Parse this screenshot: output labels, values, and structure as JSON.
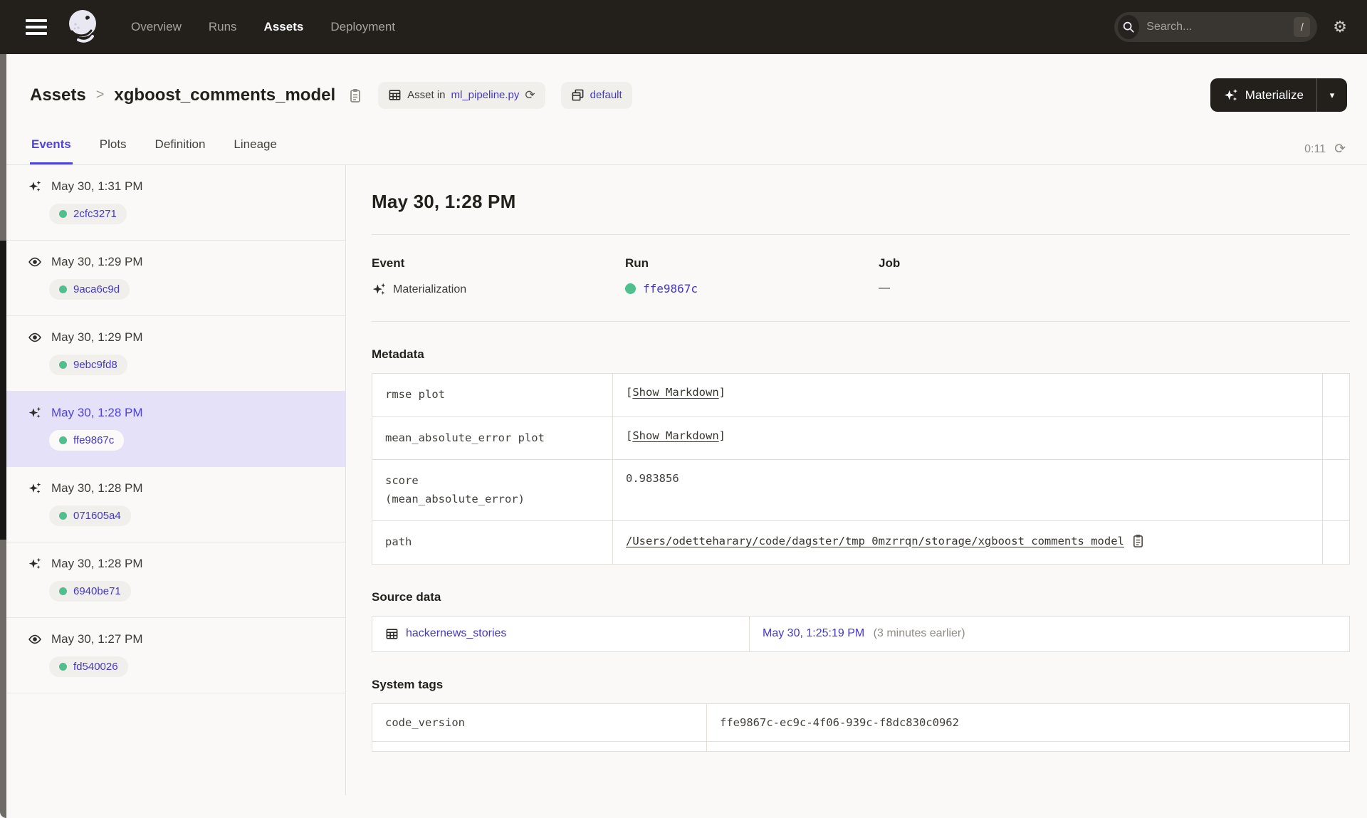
{
  "header": {
    "nav": [
      {
        "label": "Overview"
      },
      {
        "label": "Runs"
      },
      {
        "label": "Assets"
      },
      {
        "label": "Deployment"
      }
    ],
    "search": {
      "placeholder": "Search...",
      "shortcut": "/"
    }
  },
  "breadcrumb": {
    "root": "Assets",
    "separator": ">",
    "current": "xgboost_comments_model"
  },
  "asset_pill": {
    "prefix": "Asset in",
    "link": "ml_pipeline.py"
  },
  "repo_pill": {
    "label": "default"
  },
  "materialize": {
    "label": "Materialize"
  },
  "tabs": {
    "items": [
      {
        "label": "Events"
      },
      {
        "label": "Plots"
      },
      {
        "label": "Definition"
      },
      {
        "label": "Lineage"
      }
    ],
    "timer": "0:11"
  },
  "sidebar": {
    "events": [
      {
        "time": "May 30, 1:31 PM",
        "run_id": "2cfc3271",
        "type": "materialization"
      },
      {
        "time": "May 30, 1:29 PM",
        "run_id": "9aca6c9d",
        "type": "observation"
      },
      {
        "time": "May 30, 1:29 PM",
        "run_id": "9ebc9fd8",
        "type": "observation"
      },
      {
        "time": "May 30, 1:28 PM",
        "run_id": "ffe9867c",
        "type": "materialization",
        "selected": true
      },
      {
        "time": "May 30, 1:28 PM",
        "run_id": "071605a4",
        "type": "materialization"
      },
      {
        "time": "May 30, 1:28 PM",
        "run_id": "6940be71",
        "type": "materialization"
      },
      {
        "time": "May 30, 1:27 PM",
        "run_id": "fd540026",
        "type": "observation"
      }
    ]
  },
  "detail": {
    "title": "May 30, 1:28 PM",
    "event_label": "Event",
    "event_value": "Materialization",
    "run_label": "Run",
    "run_value": "ffe9867c",
    "job_label": "Job",
    "job_value": "—",
    "metadata": {
      "heading": "Metadata",
      "rows": [
        {
          "key": "rmse plot",
          "value": "Show Markdown",
          "bracket_open": "[",
          "bracket_close": "]"
        },
        {
          "key": "mean_absolute_error plot",
          "value": "Show Markdown",
          "bracket_open": "[",
          "bracket_close": "]"
        },
        {
          "key": "score",
          "key2": "(mean_absolute_error)",
          "value": "0.983856"
        },
        {
          "key": "path",
          "value": "/Users/odetteharary/code/dagster/tmp_0mzrrqn/storage/xgboost_comments_model"
        }
      ]
    },
    "source_data": {
      "heading": "Source data",
      "asset": "hackernews_stories",
      "timestamp": "May 30, 1:25:19 PM",
      "relative": "(3 minutes earlier)"
    },
    "system_tags": {
      "heading": "System tags",
      "rows": [
        {
          "key": "code_version",
          "value": "ffe9867c-ec9c-4f06-939c-f8dc830c0962"
        }
      ]
    }
  }
}
